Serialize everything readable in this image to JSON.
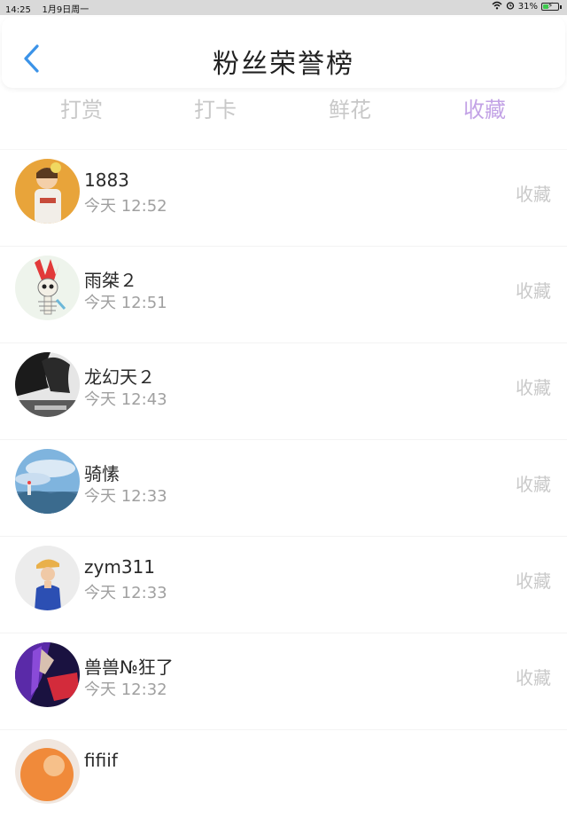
{
  "status_bar": {
    "time": "14:25",
    "date": "1月9日周一",
    "battery": "31%",
    "battery_level": 0.31
  },
  "header": {
    "title": "粉丝荣誉榜"
  },
  "tabs": [
    {
      "label": "打赏",
      "active": false
    },
    {
      "label": "打卡",
      "active": false
    },
    {
      "label": "鲜花",
      "active": false
    },
    {
      "label": "收藏",
      "active": true
    }
  ],
  "colors": {
    "accent_tab": "#c3a3e6",
    "back_arrow": "#3b93e8",
    "inactive_text": "#c8c8c8"
  },
  "fans": [
    {
      "name": "1883",
      "time": "今天 12:52",
      "action": "收藏",
      "avatar": "avatar-girl-yellow-bg"
    },
    {
      "name": "雨桀２",
      "time": "今天 12:51",
      "action": "收藏",
      "avatar": "avatar-skeleton-mohawk"
    },
    {
      "name": "龙幻天２",
      "time": "今天 12:43",
      "action": "收藏",
      "avatar": "avatar-bw-girl"
    },
    {
      "name": "骑愫",
      "time": "今天 12:33",
      "action": "收藏",
      "avatar": "avatar-sky-landscape"
    },
    {
      "name": "zym311",
      "time": "今天 12:33",
      "action": "收藏",
      "avatar": "avatar-girl-cap"
    },
    {
      "name": "兽兽№狂了",
      "time": "今天 12:32",
      "action": "收藏",
      "avatar": "avatar-anime-purple"
    },
    {
      "name": "fifiif",
      "time": "",
      "action": "",
      "avatar": "avatar-orange-partial"
    }
  ]
}
